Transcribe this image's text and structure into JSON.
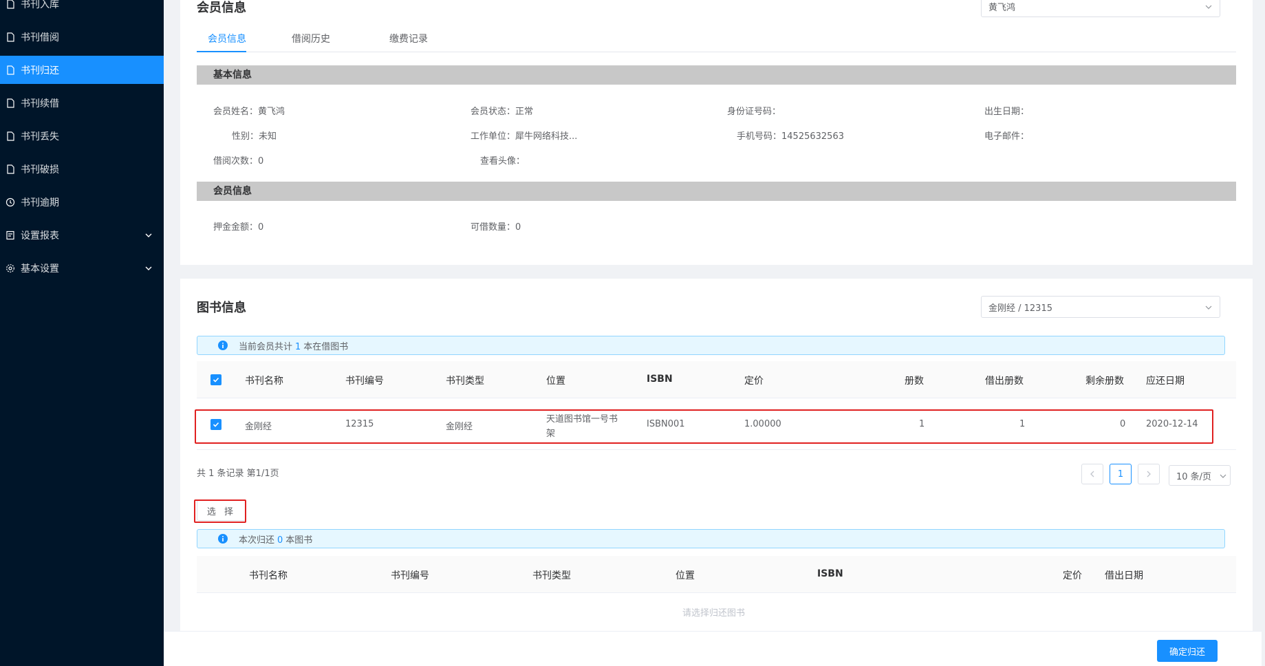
{
  "sidebar": {
    "items": [
      {
        "label": "书刊入库",
        "icon": "file-icon"
      },
      {
        "label": "书刊借阅",
        "icon": "file-icon"
      },
      {
        "label": "书刊归还",
        "icon": "file-icon",
        "active": true
      },
      {
        "label": "书刊续借",
        "icon": "file-icon"
      },
      {
        "label": "书刊丢失",
        "icon": "file-icon"
      },
      {
        "label": "书刊破损",
        "icon": "file-icon"
      },
      {
        "label": "书刊逾期",
        "icon": "clock-icon"
      },
      {
        "label": "设置报表",
        "icon": "report-icon",
        "expandable": true
      },
      {
        "label": "基本设置",
        "icon": "gear-icon",
        "expandable": true
      }
    ]
  },
  "member": {
    "title": "会员信息",
    "select_value": "黄飞鸿",
    "tabs": [
      "会员信息",
      "借阅历史",
      "缴费记录"
    ],
    "basic_section": "基本信息",
    "fields": {
      "name_label": "会员姓名：",
      "name": "黄飞鸿",
      "status_label": "会员状态：",
      "status": "正常",
      "id_label": "身份证号码：",
      "id": "",
      "birth_label": "出生日期：",
      "birth": "",
      "gender_label": "性别：",
      "gender": "未知",
      "work_label": "工作单位：",
      "work": "犀牛网络科技...",
      "phone_label": "手机号码：",
      "phone": "14525632563",
      "email_label": "电子邮件：",
      "email": "",
      "borrow_count_label": "借阅次数：",
      "borrow_count": "0",
      "avatar_label": "查看头像："
    },
    "member_section": "会员信息",
    "deposit_label": "押金金额：",
    "deposit": "0",
    "quota_label": "可借数量：",
    "quota": "0"
  },
  "books": {
    "title": "图书信息",
    "select_value": "金刚经 / 12315",
    "alert_prefix": "当前会员共计",
    "alert_count": "1",
    "alert_suffix": "本在借图书",
    "columns": [
      "书刊名称",
      "书刊编号",
      "书刊类型",
      "位置",
      "ISBN",
      "定价",
      "册数",
      "借出册数",
      "剩余册数",
      "应还日期"
    ],
    "rows": [
      {
        "name": "金刚经",
        "code": "12315",
        "type": "金刚经",
        "location_line1": "天道图书馆一号书",
        "location_line2": "架",
        "isbn": "ISBN001",
        "price": "1.00000",
        "copies": "1",
        "lent": "1",
        "remaining": "0",
        "due": "2020-12-14"
      }
    ],
    "pagination_text": "共 1 条记录 第1/1页",
    "current_page": "1",
    "page_size": "10 条/页",
    "select_button": "选 择",
    "return_alert_prefix": "本次归还",
    "return_alert_count": "0",
    "return_alert_suffix": "本图书",
    "return_columns": [
      "书刊名称",
      "书刊编号",
      "书刊类型",
      "位置",
      "ISBN",
      "定价",
      "借出日期"
    ],
    "empty_text": "请选择归还图书"
  },
  "footer": {
    "confirm_label": "确定归还"
  },
  "colors": {
    "sidebar": "#001529",
    "primary": "#1890ff",
    "highlight": "#e02020"
  }
}
